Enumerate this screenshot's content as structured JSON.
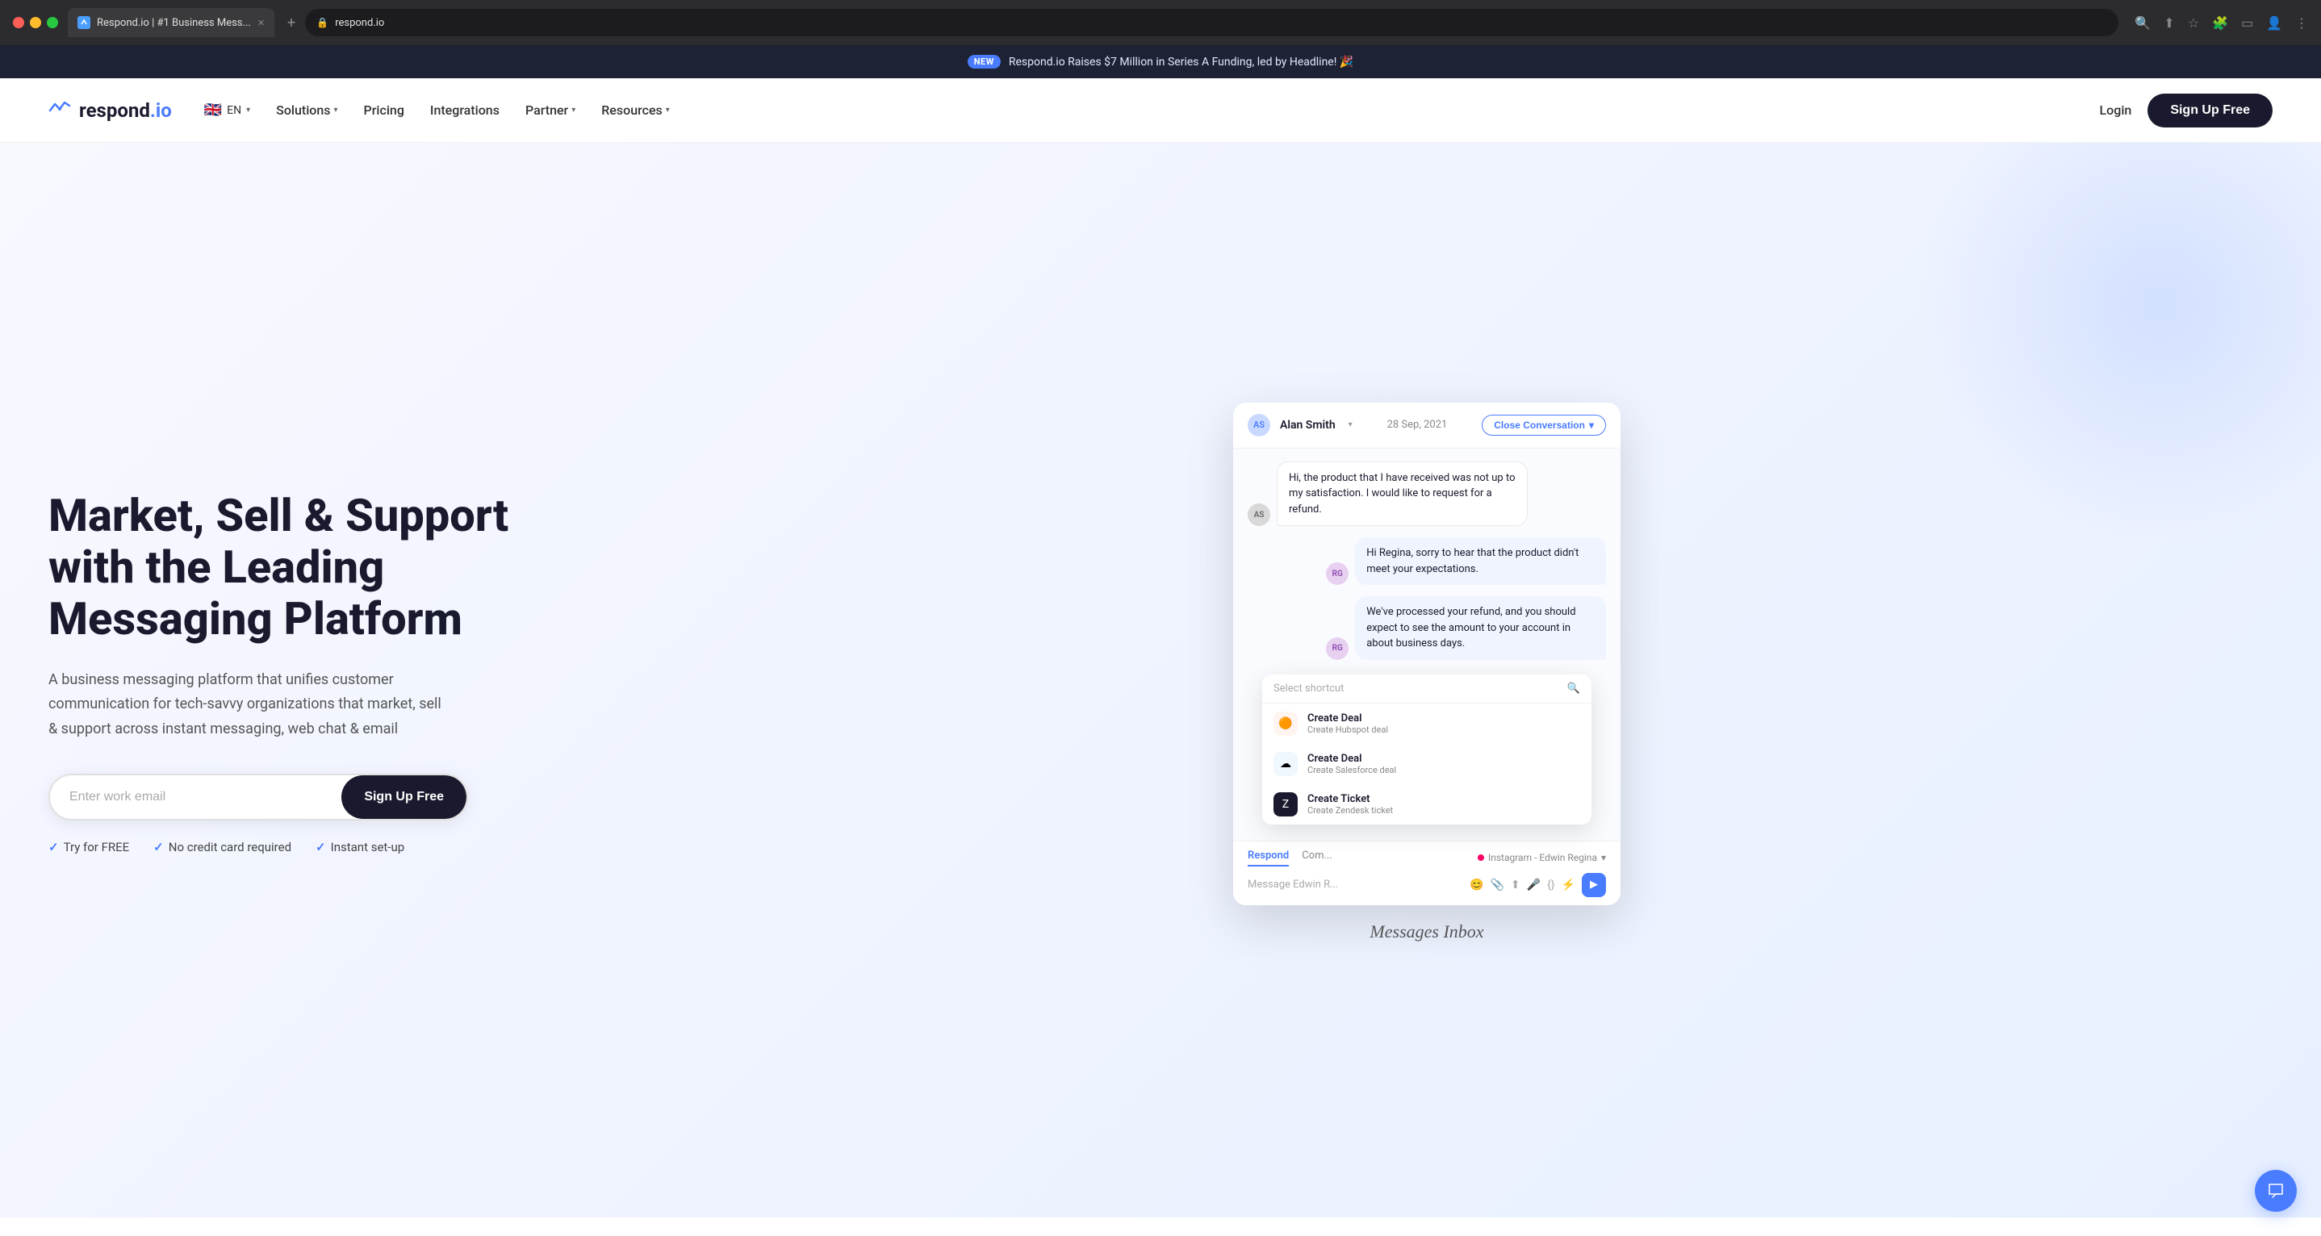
{
  "browser": {
    "tab_title": "Respond.io | #1 Business Mess...",
    "url": "respond.io",
    "new_tab_label": "+"
  },
  "announcement": {
    "badge": "NEW",
    "text": "Respond.io Raises $7 Million in Series A Funding, led by Headline! 🎉"
  },
  "nav": {
    "logo_text": "respond",
    "logo_suffix": ".io",
    "lang": "EN",
    "solutions_label": "Solutions",
    "pricing_label": "Pricing",
    "integrations_label": "Integrations",
    "partner_label": "Partner",
    "resources_label": "Resources",
    "login_label": "Login",
    "signup_label": "Sign Up Free"
  },
  "hero": {
    "title": "Market, Sell & Support\nwith the Leading\nMessaging Platform",
    "subtitle": "A business messaging platform that unifies customer communication for tech-savvy organizations that market, sell & support across instant messaging, web chat & email",
    "email_placeholder": "Enter work email",
    "signup_label": "Sign Up Free",
    "trust": {
      "item1": "Try for FREE",
      "item2": "No credit card required",
      "item3": "Instant set-up"
    }
  },
  "mockup": {
    "label": "Messages Inbox",
    "header": {
      "user_name": "Alan Smith",
      "date": "28 Sep, 2021",
      "close_btn": "Close Conversation"
    },
    "messages": [
      {
        "type": "incoming",
        "text": "Hi, the product that I have received was not up to my satisfaction. I would like to request for a refund.",
        "initials": "AS"
      },
      {
        "type": "outgoing",
        "text": "Hi Regina, sorry to hear that the product didn't meet your expectations.",
        "initials": "RG"
      },
      {
        "type": "outgoing",
        "text": "We've processed your refund, and you should expect to see the amount to your account in about business days.",
        "initials": "RG"
      }
    ],
    "shortcut": {
      "placeholder": "Select shortcut",
      "items": [
        {
          "icon_type": "hubspot",
          "title": "Create Deal",
          "desc": "Create Hubspot deal"
        },
        {
          "icon_type": "salesforce",
          "title": "Create Deal",
          "desc": "Create Salesforce deal"
        },
        {
          "icon_type": "zendesk",
          "title": "Create Ticket",
          "desc": "Create Zendesk ticket"
        }
      ]
    },
    "chat_bottom": {
      "tab_respond": "Respond",
      "tab_comment": "Com...",
      "input_placeholder": "Message Edwin R...",
      "channel": "Instagram - Edwin Regina"
    }
  }
}
